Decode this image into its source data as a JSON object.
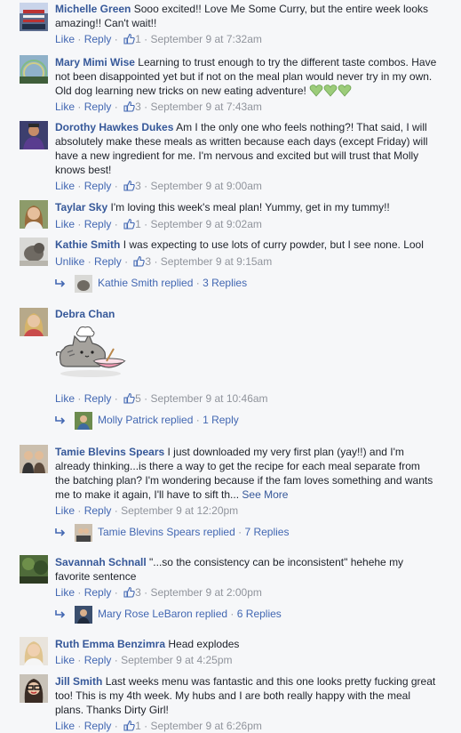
{
  "comments": [
    {
      "name": "Michelle Green",
      "text": "Sooo excited!! Love Me Some Curry, but the entire week looks amazing!! Can't wait!!",
      "like": "Like",
      "reply": "Reply",
      "likes": "1",
      "time": "September 9 at 7:32am"
    },
    {
      "name": "Mary Mimi Wise",
      "text": "Learning to trust enough to try the different taste combos. Have not been disappointed yet but if not on the meal plan would never try in my own. Old dog learning new tricks on new eating adventure!",
      "like": "Like",
      "reply": "Reply",
      "likes": "3",
      "time": "September 9 at 7:43am"
    },
    {
      "name": "Dorothy Hawkes Dukes",
      "text": "Am I the only one who feels nothing?! That said, I will absolutely make these meals as written because each days (except Friday) will have a new ingredient for me. I'm nervous and excited but will trust that Molly knows best!",
      "like": "Like",
      "reply": "Reply",
      "likes": "3",
      "time": "September 9 at 9:00am"
    },
    {
      "name": "Taylar Sky",
      "text": "I'm loving this week's meal plan! Yummy, get in my tummy!!",
      "like": "Like",
      "reply": "Reply",
      "likes": "1",
      "time": "September 9 at 9:02am"
    },
    {
      "name": "Kathie Smith",
      "text": "I was expecting to use lots of curry powder, but I see none. Lool",
      "like": "Unlike",
      "reply": "Reply",
      "likes": "3",
      "time": "September 9 at 9:15am",
      "replies": {
        "who": "Kathie Smith replied",
        "count": "3 Replies"
      }
    },
    {
      "name": "Debra Chan",
      "text": "",
      "like": "Like",
      "reply": "Reply",
      "likes": "5",
      "time": "September 9 at 10:46am",
      "replies": {
        "who": "Molly Patrick replied",
        "count": "1 Reply"
      }
    },
    {
      "name": "Tamie Blevins Spears",
      "text": "I just downloaded my very first plan (yay!!) and I'm already thinking...is there a way to get the recipe for each meal separate from the batching plan? I'm wondering because if the fam loves something and wants me to make it again, I'll have to sift th...",
      "see_more": "See More",
      "like": "Like",
      "reply": "Reply",
      "time": "September 9 at 12:20pm",
      "replies": {
        "who": "Tamie Blevins Spears replied",
        "count": "7 Replies"
      }
    },
    {
      "name": "Savannah Schnall",
      "text": "\"...so the consistency can be inconsistent\" hehehe my favorite sentence",
      "like": "Like",
      "reply": "Reply",
      "likes": "3",
      "time": "September 9 at 2:00pm",
      "replies": {
        "who": "Mary Rose LeBaron replied",
        "count": "6 Replies"
      }
    },
    {
      "name": "Ruth Emma Benzimra",
      "text": "Head explodes",
      "like": "Like",
      "reply": "Reply",
      "time": "September 9 at 4:25pm"
    },
    {
      "name": "Jill Smith",
      "text": "Last weeks menu was fantastic and this one looks pretty fucking great too! This is my 4th week. My hubs and I are both really happy with the meal plans. Thanks Dirty Girl!",
      "like": "Like",
      "reply": "Reply",
      "likes": "1",
      "time": "September 9 at 6:26pm"
    }
  ],
  "separator": "·",
  "icons": {
    "like": "thumbs-up-icon",
    "reply_arrow": "reply-arrow-icon",
    "hearts": "green-heart-icon",
    "sticker": "pusheen-cat-stirring-bowl-sticker"
  },
  "colors": {
    "name": "#365899",
    "link": "#4267b2",
    "meta": "#90949c",
    "text": "#1d2129",
    "background": "#f6f7f9"
  }
}
